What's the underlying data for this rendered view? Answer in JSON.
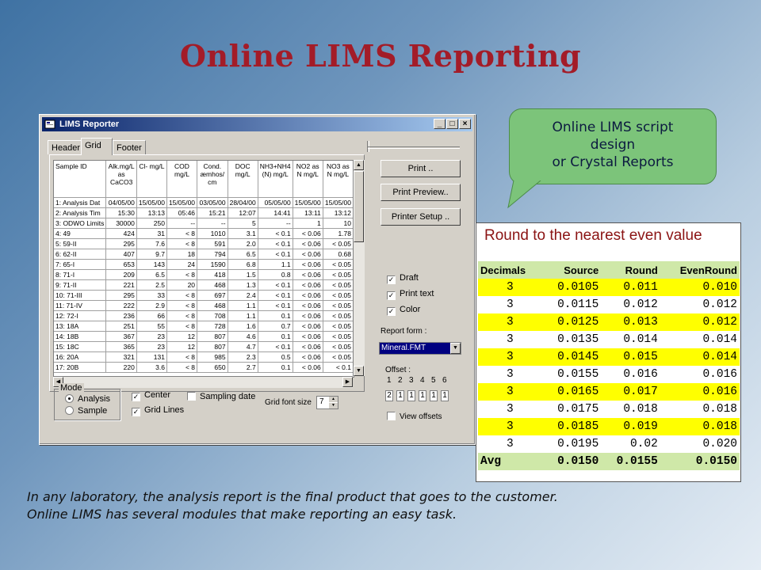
{
  "slide": {
    "title": "Online LIMS Reporting",
    "callout": [
      "Online LIMS script",
      "design",
      "or Crystal Reports"
    ],
    "caption": [
      "In any laboratory, the analysis report is the final product that goes to the customer.",
      "Online LIMS has several modules that make reporting an easy task."
    ]
  },
  "window": {
    "title": "LIMS Reporter",
    "controls": {
      "minimize": "_",
      "maximize": "□",
      "close": "×"
    },
    "tabs": [
      "Header",
      "Grid",
      "Footer"
    ],
    "active_tab": "Grid",
    "grid": {
      "columns": [
        "Sample ID",
        "Alk.mg/L as CaCO3",
        "Cl- mg/L",
        "COD mg/L",
        "Cond. æmhos/ cm",
        "DOC mg/L",
        "NH3+NH4 (N) mg/L",
        "NO2 as N mg/L",
        "NO3 as N mg/L"
      ],
      "rows": [
        [
          "1: Analysis Dat",
          "04/05/00",
          "15/05/00",
          "15/05/00",
          "03/05/00",
          "28/04/00",
          "05/05/00",
          "15/05/00",
          "15/05/00"
        ],
        [
          "2: Analysis Tim",
          "15:30",
          "13:13",
          "05:46",
          "15:21",
          "12:07",
          "14:41",
          "13:11",
          "13:12"
        ],
        [
          "3: ODWO Limits",
          "30000",
          "250",
          "--",
          "--",
          "5",
          "--",
          "1",
          "10"
        ],
        [
          "4: 49",
          "424",
          "31",
          "< 8",
          "1010",
          "3.1",
          "< 0.1",
          "< 0.06",
          "1.78"
        ],
        [
          "5: 59-II",
          "295",
          "7.6",
          "< 8",
          "591",
          "2.0",
          "< 0.1",
          "< 0.06",
          "< 0.05"
        ],
        [
          "6: 62-II",
          "407",
          "9.7",
          "18",
          "794",
          "6.5",
          "< 0.1",
          "< 0.06",
          "0.68"
        ],
        [
          "7: 65-I",
          "653",
          "143",
          "24",
          "1590",
          "6.8",
          "1.1",
          "< 0.06",
          "< 0.05"
        ],
        [
          "8: 71-I",
          "209",
          "6.5",
          "< 8",
          "418",
          "1.5",
          "0.8",
          "< 0.06",
          "< 0.05"
        ],
        [
          "9: 71-II",
          "221",
          "2.5",
          "20",
          "468",
          "1.3",
          "< 0.1",
          "< 0.06",
          "< 0.05"
        ],
        [
          "10: 71-III",
          "295",
          "33",
          "< 8",
          "697",
          "2.4",
          "< 0.1",
          "< 0.06",
          "< 0.05"
        ],
        [
          "11: 71-IV",
          "222",
          "2.9",
          "< 8",
          "468",
          "1.1",
          "< 0.1",
          "< 0.06",
          "< 0.05"
        ],
        [
          "12: 72-I",
          "236",
          "66",
          "< 8",
          "708",
          "1.1",
          "0.1",
          "< 0.06",
          "< 0.05"
        ],
        [
          "13: 18A",
          "251",
          "55",
          "< 8",
          "728",
          "1.6",
          "0.7",
          "< 0.06",
          "< 0.05"
        ],
        [
          "14: 18B",
          "367",
          "23",
          "12",
          "807",
          "4.6",
          "0.1",
          "< 0.06",
          "< 0.05"
        ],
        [
          "15: 18C",
          "365",
          "23",
          "12",
          "807",
          "4.7",
          "< 0.1",
          "< 0.06",
          "< 0.05"
        ],
        [
          "16: 20A",
          "321",
          "131",
          "< 8",
          "985",
          "2.3",
          "0.5",
          "< 0.06",
          "< 0.05"
        ],
        [
          "17: 20B",
          "220",
          "3.6",
          "< 8",
          "650",
          "2.7",
          "0.1",
          "< 0.06",
          "< 0.1"
        ]
      ]
    },
    "buttons": {
      "print": "Print ..",
      "print_preview": "Print Preview..",
      "printer_setup": "Printer Setup .."
    },
    "options": {
      "draft": {
        "label": "Draft",
        "checked": true
      },
      "print_text": {
        "label": "Print text",
        "checked": true
      },
      "color": {
        "label": "Color",
        "checked": true
      }
    },
    "report_form": {
      "label": "Report form :",
      "value": "Mineral.FMT"
    },
    "offset": {
      "label": "Offset :",
      "numbers": [
        "1",
        "2",
        "3",
        "4",
        "5",
        "6"
      ],
      "values": [
        "2",
        "1",
        "1",
        "1",
        "1",
        "1"
      ],
      "view_offsets": {
        "label": "View offsets",
        "checked": false
      }
    },
    "mode": {
      "label": "Mode",
      "analysis": "Analysis",
      "sample": "Sample",
      "selected": "Analysis"
    },
    "center": {
      "label": "Center",
      "checked": true
    },
    "grid_lines": {
      "label": "Grid Lines",
      "checked": true
    },
    "sampling_date": {
      "label": "Sampling date",
      "checked": false
    },
    "grid_font_size": {
      "label": "Grid font size",
      "value": "7"
    }
  },
  "round_table": {
    "title": "Round to the nearest even value",
    "headers": [
      "Decimals",
      "Source",
      "Round",
      "EvenRound"
    ],
    "rows": [
      [
        "3",
        "0.0105",
        "0.011",
        "0.010"
      ],
      [
        "3",
        "0.0115",
        "0.012",
        "0.012"
      ],
      [
        "3",
        "0.0125",
        "0.013",
        "0.012"
      ],
      [
        "3",
        "0.0135",
        "0.014",
        "0.014"
      ],
      [
        "3",
        "0.0145",
        "0.015",
        "0.014"
      ],
      [
        "3",
        "0.0155",
        "0.016",
        "0.016"
      ],
      [
        "3",
        "0.0165",
        "0.017",
        "0.016"
      ],
      [
        "3",
        "0.0175",
        "0.018",
        "0.018"
      ],
      [
        "3",
        "0.0185",
        "0.019",
        "0.018"
      ],
      [
        "3",
        "0.0195",
        "0.02",
        "0.020"
      ]
    ],
    "avg": [
      "Avg",
      "0.0150",
      "0.0155",
      "0.0150"
    ],
    "colors": {
      "title": "#8b1414",
      "header_bg": "#cfe8a8",
      "highlight": "#ffff00"
    }
  },
  "colors": {
    "title": "#a31c28",
    "callout": "#7cc47a",
    "titlebar": "#0a246a"
  }
}
